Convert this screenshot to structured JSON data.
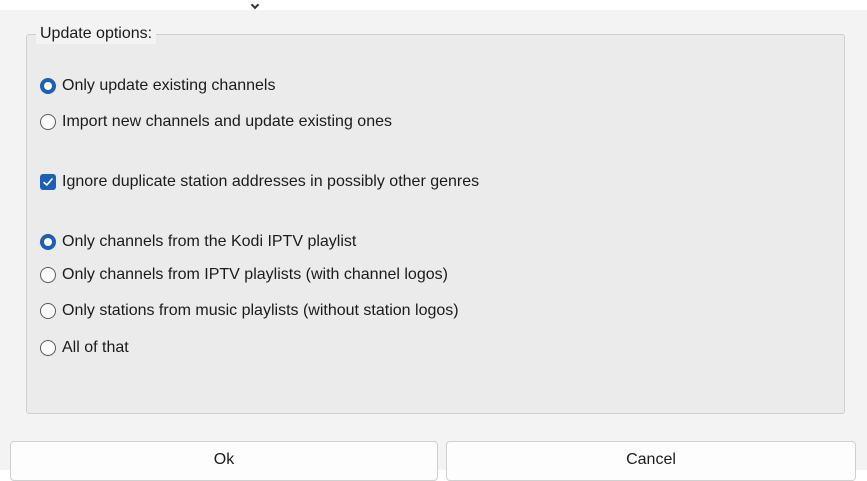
{
  "group": {
    "title": "Update options:"
  },
  "update_mode": {
    "options": [
      {
        "label": "Only update existing channels",
        "checked": true
      },
      {
        "label": "Import new channels and update existing ones",
        "checked": false
      }
    ]
  },
  "ignore_duplicates": {
    "label": "Ignore duplicate station addresses in possibly other genres",
    "checked": true
  },
  "source": {
    "options": [
      {
        "label": "Only channels from the Kodi IPTV playlist",
        "checked": true
      },
      {
        "label": "Only channels from IPTV playlists (with channel logos)",
        "checked": false
      },
      {
        "label": "Only stations from music playlists (without station logos)",
        "checked": false
      },
      {
        "label": "All of that",
        "checked": false
      }
    ]
  },
  "buttons": {
    "ok": "Ok",
    "cancel": "Cancel"
  },
  "colors": {
    "accent": "#1c5fb5"
  }
}
